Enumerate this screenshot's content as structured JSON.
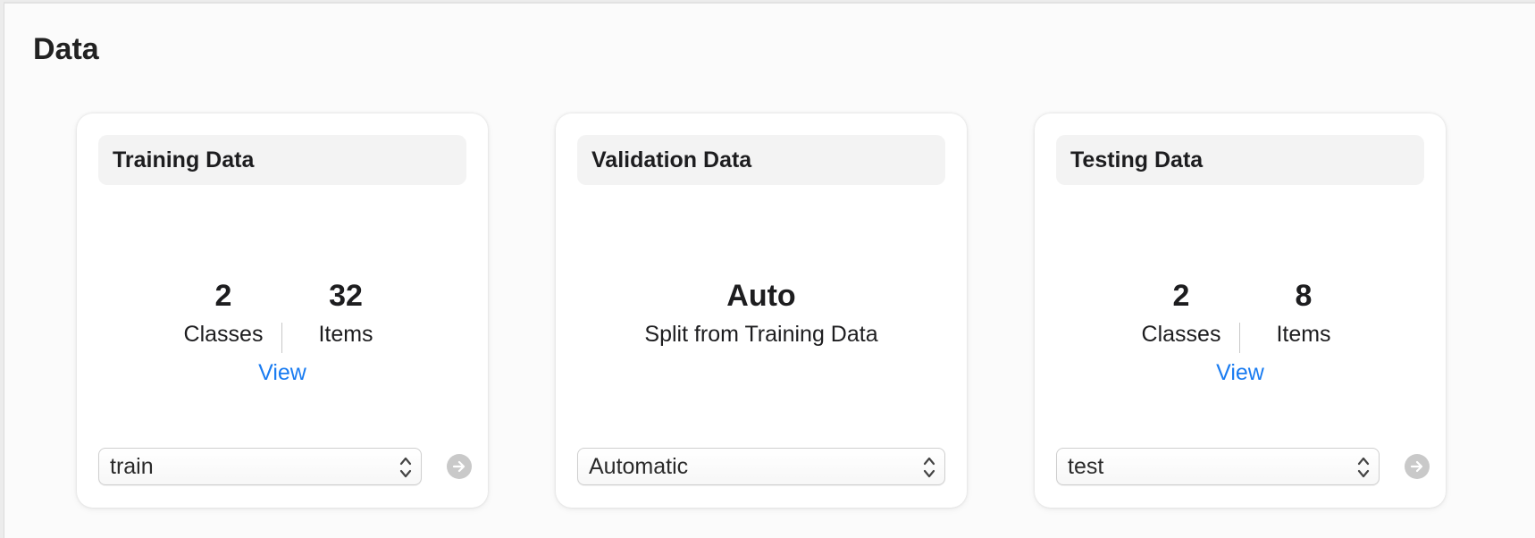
{
  "section": {
    "title": "Data"
  },
  "training": {
    "title": "Training Data",
    "classes_value": "2",
    "classes_label": "Classes",
    "items_value": "32",
    "items_label": "Items",
    "view_label": "View",
    "select_value": "train"
  },
  "validation": {
    "title": "Validation Data",
    "mode": "Auto",
    "description": "Split from Training Data",
    "select_value": "Automatic"
  },
  "testing": {
    "title": "Testing Data",
    "classes_value": "2",
    "classes_label": "Classes",
    "items_value": "8",
    "items_label": "Items",
    "view_label": "View",
    "select_value": "test"
  },
  "icons": {
    "select": "up-down-chevron-icon",
    "go": "arrow-right-circle-icon"
  },
  "colors": {
    "link": "#1a7cf1",
    "go_button": "#c9c9c9"
  }
}
